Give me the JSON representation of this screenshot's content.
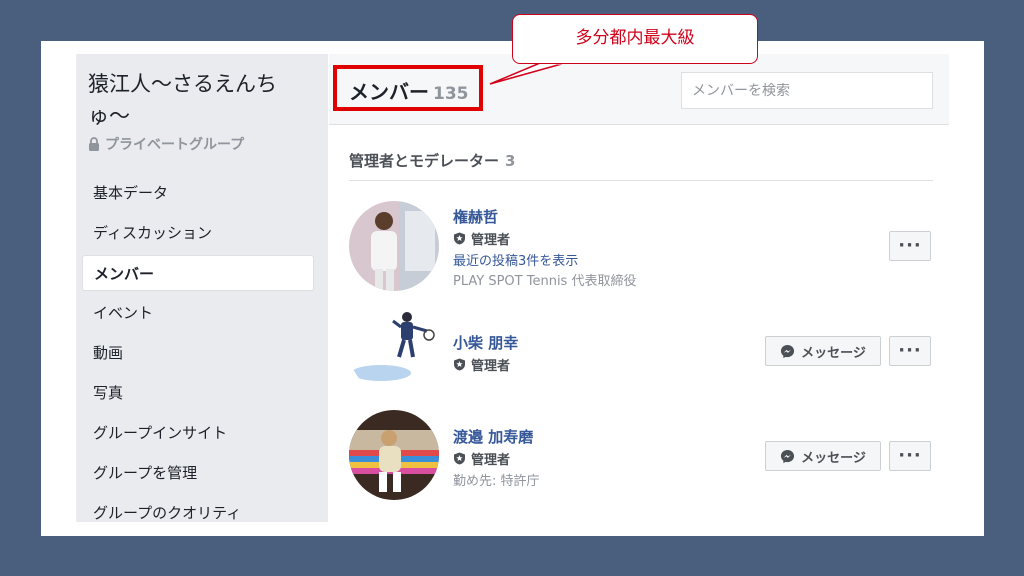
{
  "callout": {
    "text": "多分都内最大級"
  },
  "sidebar": {
    "group_title": "猿江人〜さるえんちゅ〜",
    "privacy_label": "プライベートグループ",
    "items": [
      {
        "label": "基本データ",
        "active": false
      },
      {
        "label": "ディスカッション",
        "active": false
      },
      {
        "label": "メンバー",
        "active": true
      },
      {
        "label": "イベント",
        "active": false
      },
      {
        "label": "動画",
        "active": false
      },
      {
        "label": "写真",
        "active": false
      },
      {
        "label": "グループインサイト",
        "active": false
      },
      {
        "label": "グループを管理",
        "active": false
      },
      {
        "label": "グループのクオリティ",
        "active": false
      }
    ]
  },
  "header": {
    "title": "メンバー",
    "count": "135",
    "search_placeholder": "メンバーを検索"
  },
  "section": {
    "title": "管理者とモデレーター",
    "count": "3"
  },
  "members": [
    {
      "name": "権赫哲",
      "role": "管理者",
      "link": "最近の投稿3件を表示",
      "sub": "PLAY SPOT Tennis 代表取締役"
    },
    {
      "name": "小柴 朋幸",
      "role": "管理者",
      "message_label": "メッセージ"
    },
    {
      "name": "渡邉 加寿磨",
      "role": "管理者",
      "sub": "勤め先: 特許庁",
      "message_label": "メッセージ"
    }
  ],
  "colors": {
    "background": "#4a5f7e",
    "link": "#365899",
    "highlight": "#e10000",
    "callout": "#d0021b"
  }
}
